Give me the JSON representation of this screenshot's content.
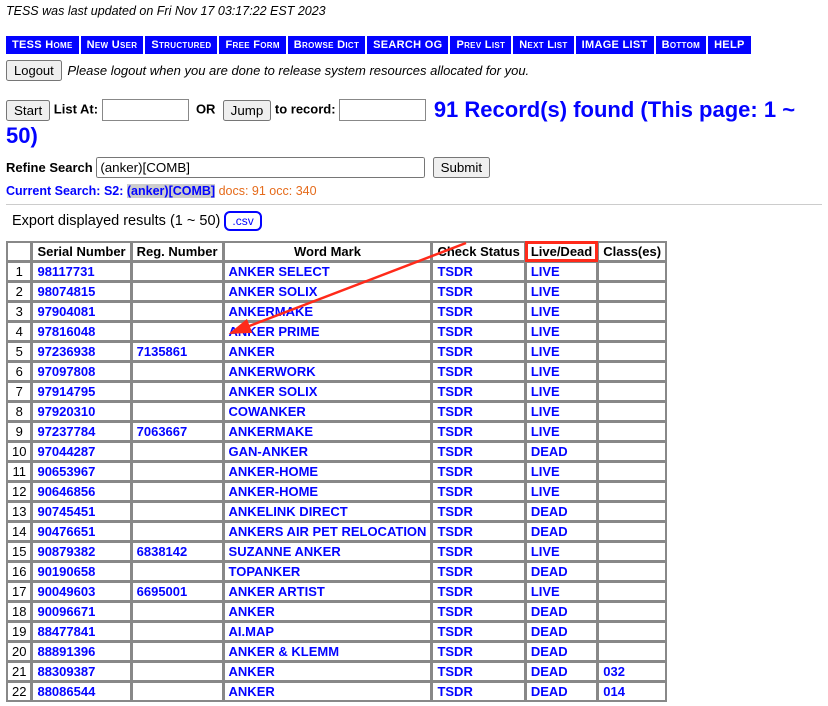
{
  "update_line": "TESS was last updated on Fri Nov 17 03:17:22 EST 2023",
  "nav": [
    "TESS Home",
    "New User",
    "Structured",
    "Free Form",
    "Browse Dict",
    "SEARCH OG",
    "Prev List",
    "Next List",
    "IMAGE LIST",
    "Bottom",
    "HELP"
  ],
  "logout": {
    "button": "Logout",
    "msg": "Please logout when you are done to release system resources allocated for you."
  },
  "controls": {
    "start": "Start",
    "list_at_label": "List At:",
    "or_label": "OR",
    "jump": "Jump",
    "to_record_label": "to record:",
    "records_count": "91",
    "records_suffix": " Record(s) found (This page: 1 ~ 50)"
  },
  "refine": {
    "label": "Refine Search",
    "value": "(anker)[COMB]",
    "submit": "Submit"
  },
  "current_search": {
    "label": "Current Search:",
    "prefix": " S2: ",
    "query": "(anker)[COMB]",
    "docs": "docs: 91 occ: 340"
  },
  "export": {
    "label": "Export displayed results (1 ~ 50) ",
    "csv": ".csv"
  },
  "headers": [
    "",
    "Serial Number",
    "Reg. Number",
    "Word Mark",
    "Check Status",
    "Live/Dead",
    "Class(es)"
  ],
  "rows": [
    {
      "n": "1",
      "serial": "98117731",
      "reg": "",
      "mark": "ANKER SELECT",
      "cs": "TSDR",
      "ld": "LIVE",
      "cl": ""
    },
    {
      "n": "2",
      "serial": "98074815",
      "reg": "",
      "mark": "ANKER SOLIX",
      "cs": "TSDR",
      "ld": "LIVE",
      "cl": ""
    },
    {
      "n": "3",
      "serial": "97904081",
      "reg": "",
      "mark": "ANKERMAKE",
      "cs": "TSDR",
      "ld": "LIVE",
      "cl": ""
    },
    {
      "n": "4",
      "serial": "97816048",
      "reg": "",
      "mark": "ANKER PRIME",
      "cs": "TSDR",
      "ld": "LIVE",
      "cl": ""
    },
    {
      "n": "5",
      "serial": "97236938",
      "reg": "7135861",
      "mark": "ANKER",
      "cs": "TSDR",
      "ld": "LIVE",
      "cl": ""
    },
    {
      "n": "6",
      "serial": "97097808",
      "reg": "",
      "mark": "ANKERWORK",
      "cs": "TSDR",
      "ld": "LIVE",
      "cl": ""
    },
    {
      "n": "7",
      "serial": "97914795",
      "reg": "",
      "mark": "ANKER SOLIX",
      "cs": "TSDR",
      "ld": "LIVE",
      "cl": ""
    },
    {
      "n": "8",
      "serial": "97920310",
      "reg": "",
      "mark": "COWANKER",
      "cs": "TSDR",
      "ld": "LIVE",
      "cl": ""
    },
    {
      "n": "9",
      "serial": "97237784",
      "reg": "7063667",
      "mark": "ANKERMAKE",
      "cs": "TSDR",
      "ld": "LIVE",
      "cl": ""
    },
    {
      "n": "10",
      "serial": "97044287",
      "reg": "",
      "mark": "GAN-ANKER",
      "cs": "TSDR",
      "ld": "DEAD",
      "cl": ""
    },
    {
      "n": "11",
      "serial": "90653967",
      "reg": "",
      "mark": "ANKER-HOME",
      "cs": "TSDR",
      "ld": "LIVE",
      "cl": ""
    },
    {
      "n": "12",
      "serial": "90646856",
      "reg": "",
      "mark": "ANKER-HOME",
      "cs": "TSDR",
      "ld": "LIVE",
      "cl": ""
    },
    {
      "n": "13",
      "serial": "90745451",
      "reg": "",
      "mark": "ANKELINK DIRECT",
      "cs": "TSDR",
      "ld": "DEAD",
      "cl": ""
    },
    {
      "n": "14",
      "serial": "90476651",
      "reg": "",
      "mark": "ANKERS AIR PET RELOCATION",
      "cs": "TSDR",
      "ld": "DEAD",
      "cl": ""
    },
    {
      "n": "15",
      "serial": "90879382",
      "reg": "6838142",
      "mark": "SUZANNE ANKER",
      "cs": "TSDR",
      "ld": "LIVE",
      "cl": ""
    },
    {
      "n": "16",
      "serial": "90190658",
      "reg": "",
      "mark": "TOPANKER",
      "cs": "TSDR",
      "ld": "DEAD",
      "cl": ""
    },
    {
      "n": "17",
      "serial": "90049603",
      "reg": "6695001",
      "mark": "ANKER ARTIST",
      "cs": "TSDR",
      "ld": "LIVE",
      "cl": ""
    },
    {
      "n": "18",
      "serial": "90096671",
      "reg": "",
      "mark": "ANKER",
      "cs": "TSDR",
      "ld": "DEAD",
      "cl": ""
    },
    {
      "n": "19",
      "serial": "88477841",
      "reg": "",
      "mark": "AI.MAP",
      "cs": "TSDR",
      "ld": "DEAD",
      "cl": ""
    },
    {
      "n": "20",
      "serial": "88891396",
      "reg": "",
      "mark": "ANKER & KLEMM",
      "cs": "TSDR",
      "ld": "DEAD",
      "cl": ""
    },
    {
      "n": "21",
      "serial": "88309387",
      "reg": "",
      "mark": "ANKER",
      "cs": "TSDR",
      "ld": "DEAD",
      "cl": "032"
    },
    {
      "n": "22",
      "serial": "88086544",
      "reg": "",
      "mark": "ANKER",
      "cs": "TSDR",
      "ld": "DEAD",
      "cl": "014"
    }
  ]
}
